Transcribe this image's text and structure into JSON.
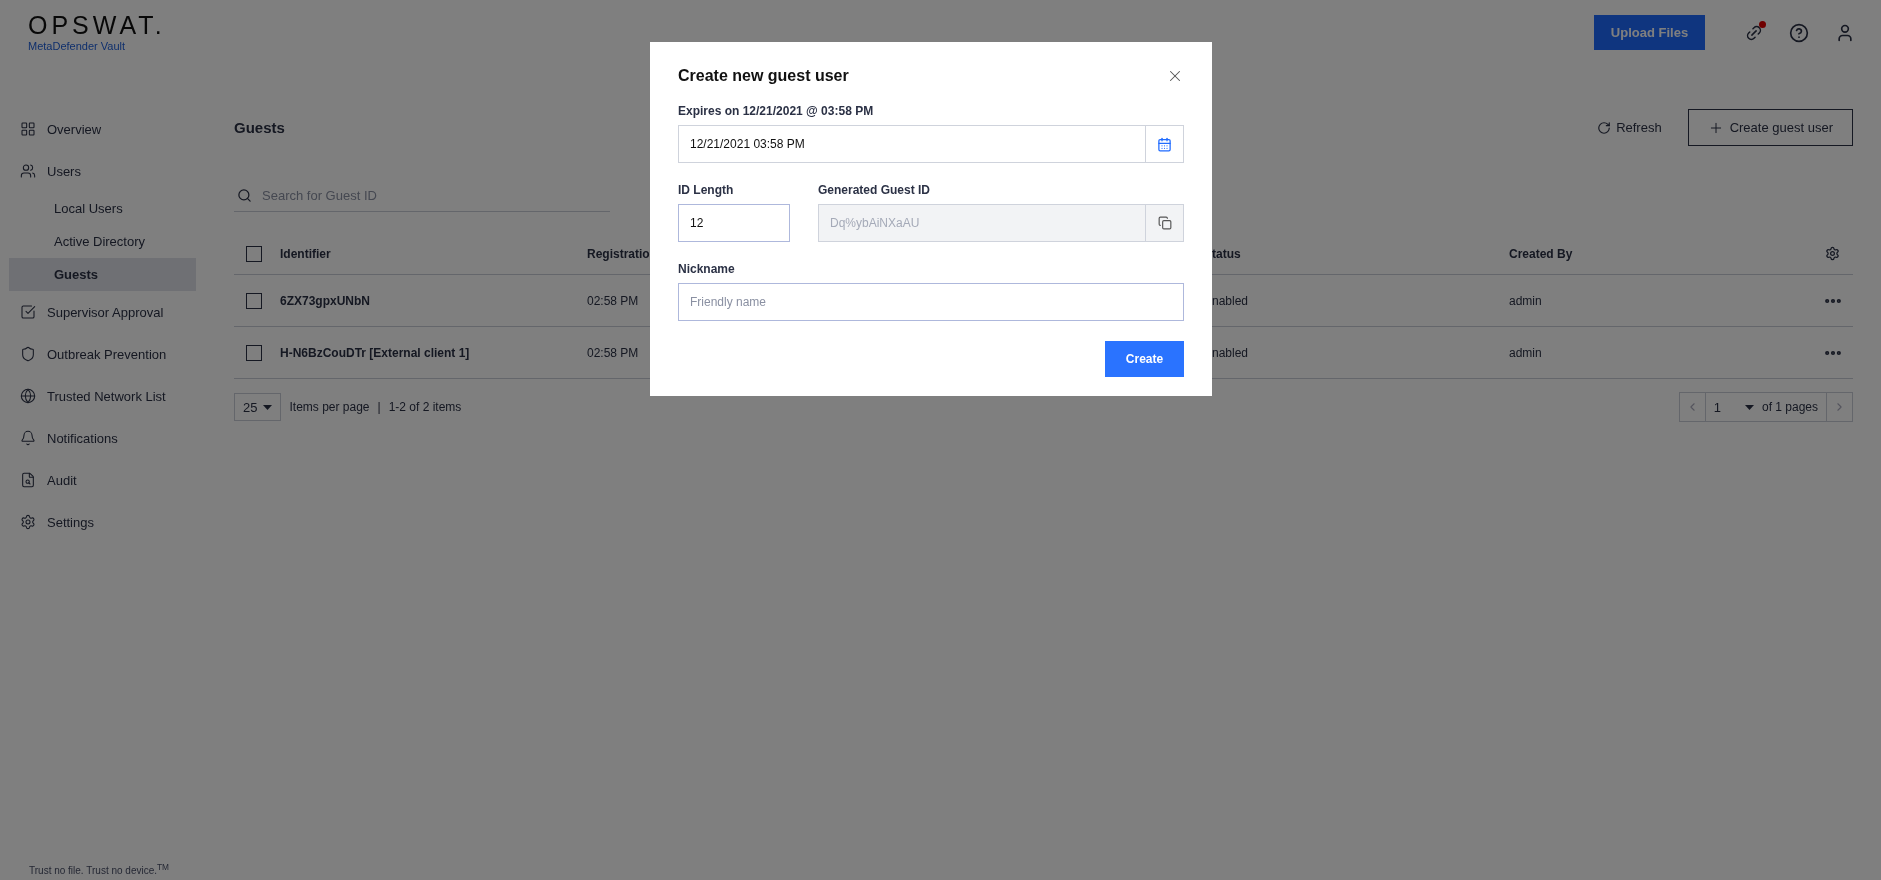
{
  "brand": {
    "logo": "OPSWAT.",
    "product": "MetaDefender Vault"
  },
  "header": {
    "upload_button": "Upload Files",
    "alert": true
  },
  "sidebar": {
    "items": [
      {
        "label": "Overview",
        "selected": false
      },
      {
        "label": "Users",
        "selected": false,
        "children": [
          {
            "label": "Local Users",
            "selected": false
          },
          {
            "label": "Active Directory",
            "selected": false
          },
          {
            "label": "Guests",
            "selected": true
          }
        ]
      },
      {
        "label": "Supervisor Approval",
        "selected": false
      },
      {
        "label": "Outbreak Prevention",
        "selected": false
      },
      {
        "label": "Trusted Network List",
        "selected": false
      },
      {
        "label": "Notifications",
        "selected": false
      },
      {
        "label": "Audit",
        "selected": false
      },
      {
        "label": "Settings",
        "selected": false
      }
    ],
    "footer": "Trust no file. Trust no device.$^{TM}$"
  },
  "page": {
    "title": "Guests",
    "refresh": "Refresh",
    "create_button": "Create guest user",
    "search": {
      "placeholder": "Search for Guest ID"
    }
  },
  "table": {
    "all_checked": false,
    "columns": [
      "Identifier",
      "Registratio",
      "tatus",
      "Created By"
    ],
    "rows": [
      {
        "checked": false,
        "identifier": "6ZX73gpxUNbN",
        "registration": "02:58 PM",
        "status": "nabled",
        "created_by": "admin"
      },
      {
        "checked": false,
        "identifier": "H-N6BzCouDTr [External client 1]",
        "registration": "02:58 PM",
        "status": "nabled",
        "created_by": "admin"
      }
    ]
  },
  "pagination": {
    "page_size": "25",
    "per_page_label": "Items per page",
    "separator": "|",
    "range": "1-2 of 2 items",
    "page": "1",
    "of_pages": "of 1 pages"
  },
  "dialog": {
    "title": "Create new guest user",
    "expires": {
      "label": "Expires on 12/21/2021 @ 03:58 PM",
      "value": "12/21/2021 03:58 PM"
    },
    "id_length": {
      "label": "ID Length",
      "value": "12"
    },
    "generated_id": {
      "label": "Generated Guest ID",
      "value": "Dq%ybAiNXaAU",
      "disabled": true
    },
    "nickname": {
      "label": "Nickname",
      "placeholder": "Friendly name"
    },
    "create_button": "Create"
  }
}
